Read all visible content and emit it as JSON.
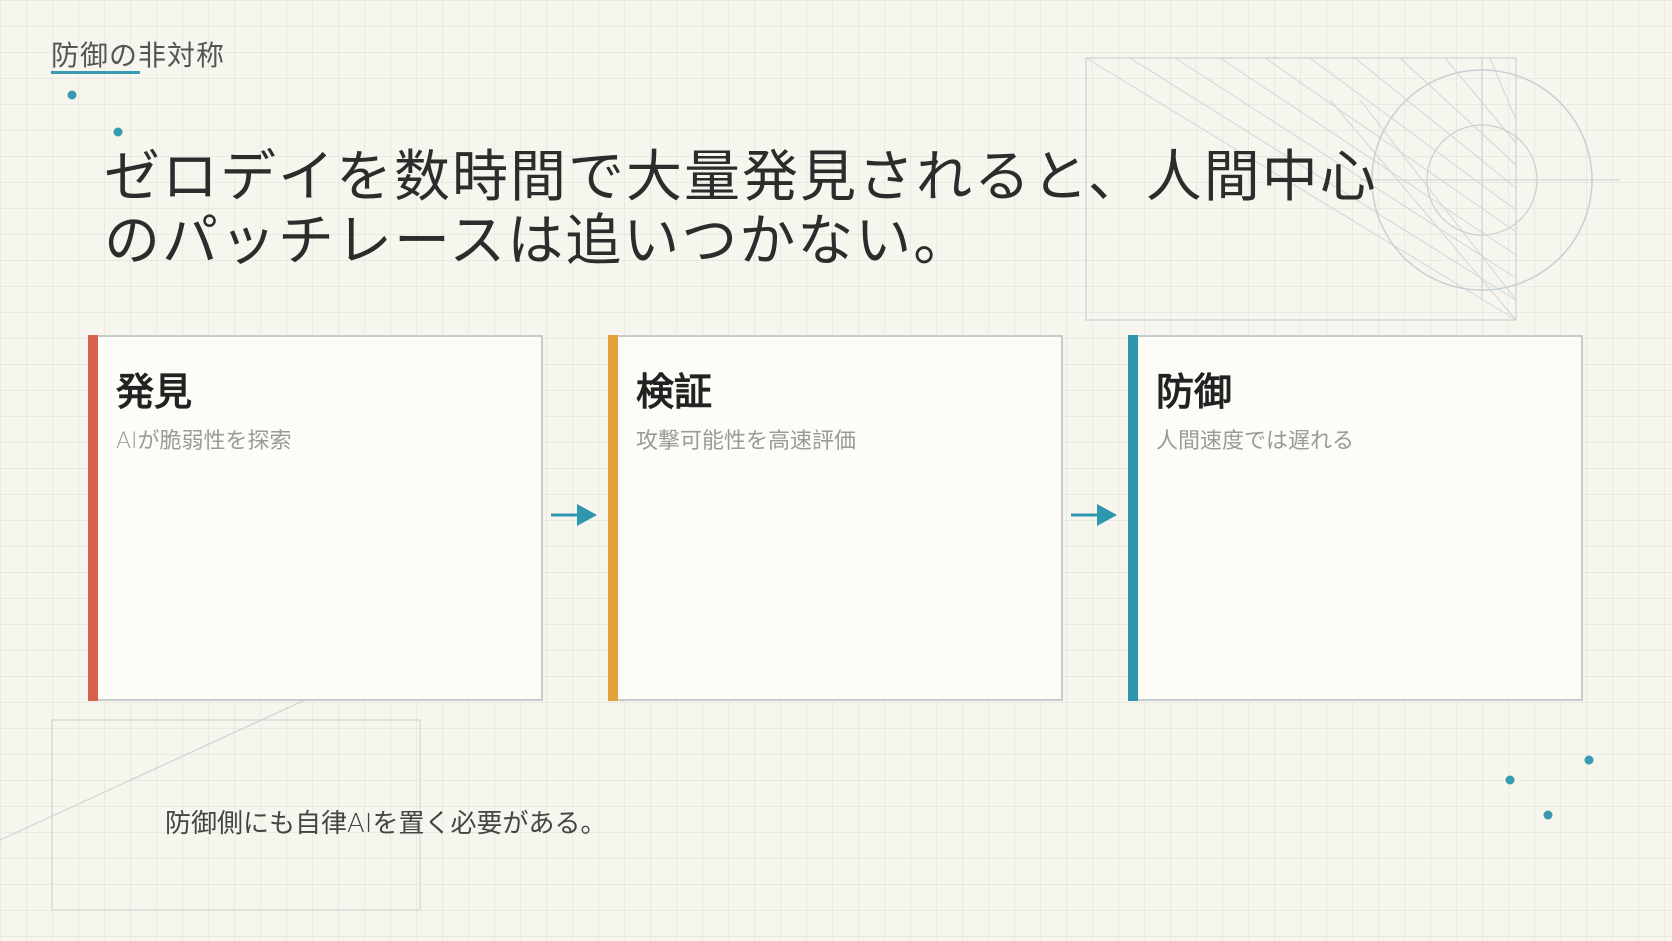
{
  "slide": {
    "section_label": "防御の非対称",
    "headline": "ゼロデイを数時間で大量発見されると、人間中心のパッチレースは追いつかない。",
    "footnote": "防御側にも自律AIを置く必要がある。"
  },
  "colors": {
    "background": "#f6f5ee",
    "accent_blue": "#3a9bb0",
    "card_red": "#d9604a",
    "card_orange": "#e3a13b",
    "card_teal": "#2f97ad"
  },
  "cards": [
    {
      "title": "発見",
      "desc": "AIが脆弱性を探索",
      "accent": "#d9604a"
    },
    {
      "title": "検証",
      "desc": "攻撃可能性を高速評価",
      "accent": "#e3a13b"
    },
    {
      "title": "防御",
      "desc": "人間速度では遅れる",
      "accent": "#2f97ad"
    }
  ],
  "icons": {
    "arrow": "arrow-right-icon"
  }
}
